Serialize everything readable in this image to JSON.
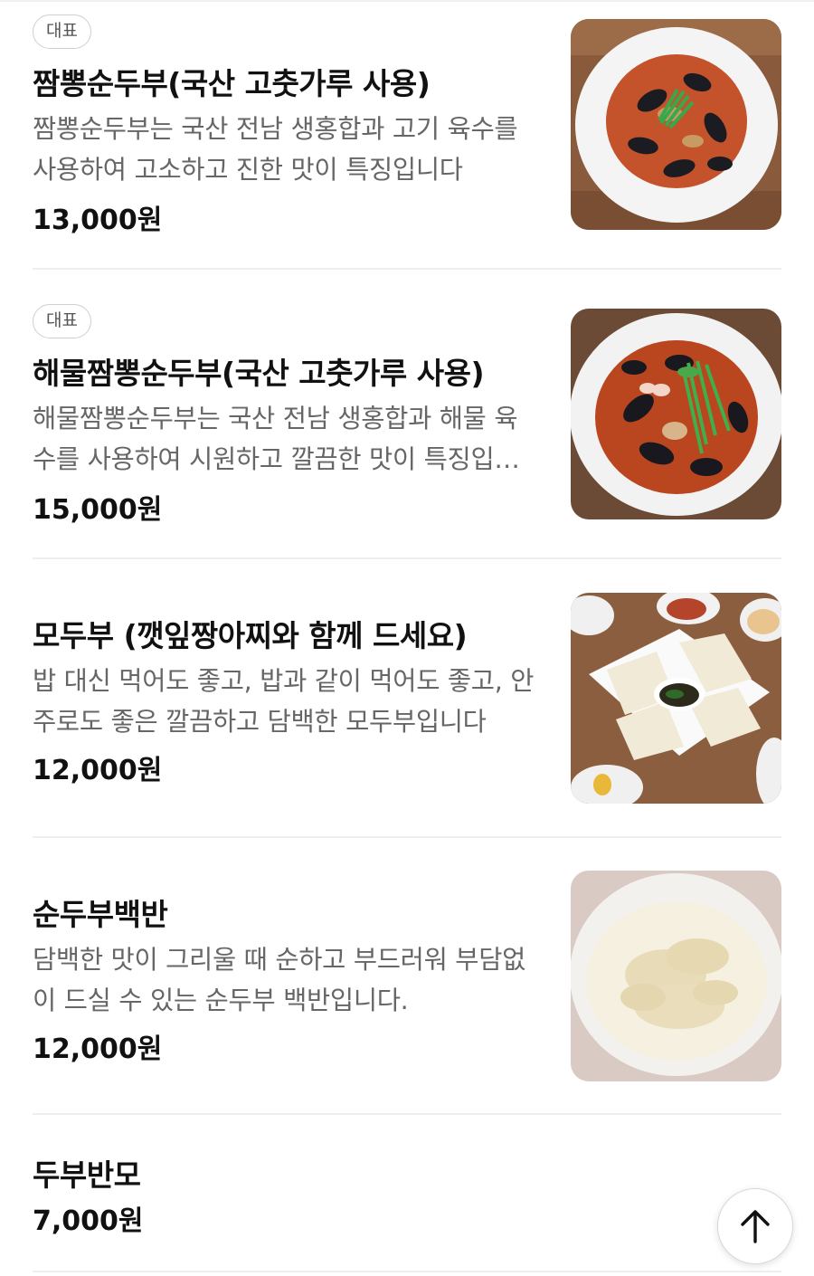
{
  "menu": {
    "items": [
      {
        "badge": "대표",
        "name": "짬뽕순두부(국산 고춧가루 사용)",
        "description": "짬뽕순두부는 국산 전남 생홍합과 고기 육수를 사용하여 고소하고 진한 맛이 특징입니다",
        "price": "13,000원",
        "image": "mussel-jjamppong-tofu-photo"
      },
      {
        "badge": "대표",
        "name": "해물짬뽕순두부(국산 고춧가루 사용)",
        "description": "해물짬뽕순두부는 국산 전남 생홍합과 해물 육수를 사용하여 시원하고 깔끔한 맛이 특징입니다",
        "price": "15,000원",
        "image": "seafood-jjamppong-tofu-photo"
      },
      {
        "name": "모두부 (깻잎짱아찌와 함께 드세요)",
        "description": "밥 대신 먹어도 좋고, 밥과 같이 먹어도 좋고, 안주로도 좋은 깔끔하고 담백한 모두부입니다",
        "price": "12,000원",
        "image": "block-tofu-photo"
      },
      {
        "name": "순두부백반",
        "description": "담백한 맛이 그리울 때 순하고 부드러워 부담없이 드실 수 있는 순두부 백반입니다.",
        "price": "12,000원",
        "image": "soft-tofu-set-photo"
      },
      {
        "name": "두부반모",
        "price": "7,000원"
      }
    ]
  },
  "scroll_top": {
    "icon": "arrow-up-icon"
  },
  "colors": {
    "text_primary": "#111111",
    "text_secondary": "#666666",
    "divider": "#eeeeee",
    "badge_border": "#cfcfcf"
  }
}
